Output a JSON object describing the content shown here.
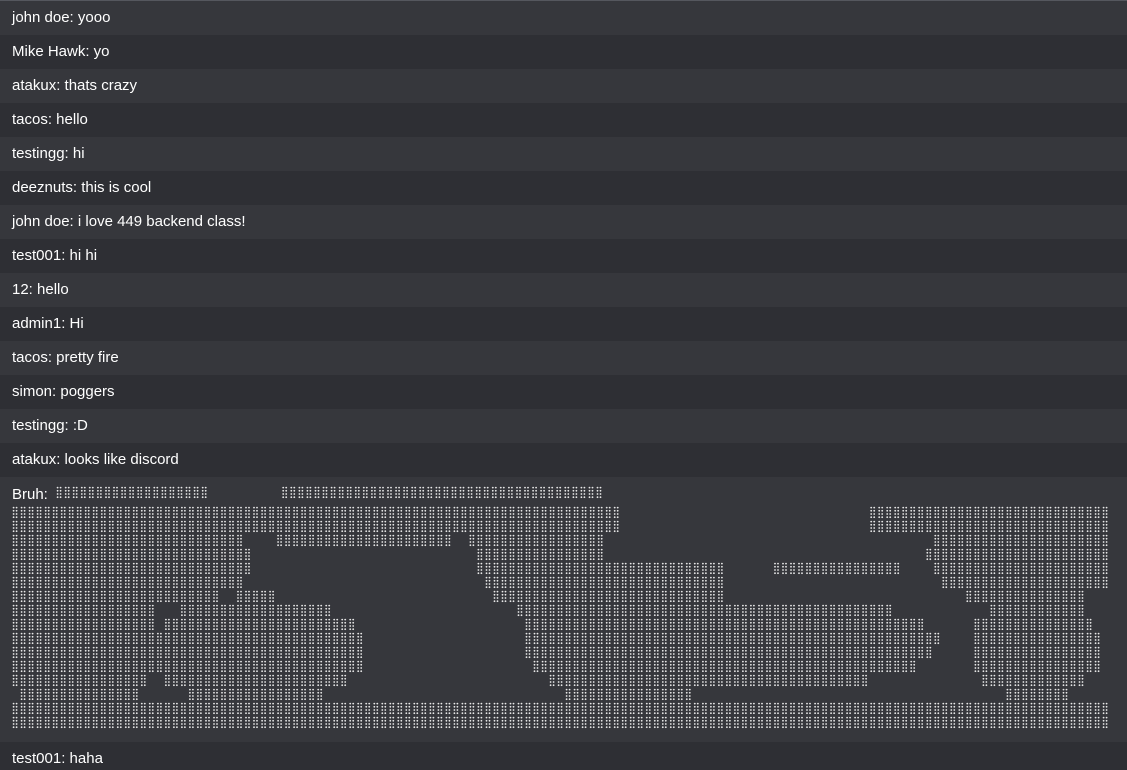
{
  "messages": [
    {
      "user": "john doe",
      "text": "yooo"
    },
    {
      "user": "Mike Hawk",
      "text": "yo"
    },
    {
      "user": "atakux",
      "text": "thats crazy"
    },
    {
      "user": "tacos",
      "text": "hello"
    },
    {
      "user": "testingg",
      "text": "hi"
    },
    {
      "user": "deeznuts",
      "text": "this is cool"
    },
    {
      "user": "john doe",
      "text": "i love 449 backend class!"
    },
    {
      "user": "test001",
      "text": "hi hi"
    },
    {
      "user": "12",
      "text": "hello"
    },
    {
      "user": "admin1",
      "text": "Hi"
    },
    {
      "user": "tacos",
      "text": "pretty fire"
    },
    {
      "user": "simon",
      "text": "poggers"
    },
    {
      "user": "testingg",
      "text": ":D"
    },
    {
      "user": "atakux",
      "text": "looks like discord"
    }
  ],
  "art_message": {
    "user": "Bruh"
  },
  "last_message": {
    "user": "test001",
    "text": "haha"
  },
  "colors": {
    "bg_dark": "#2e2f34",
    "bg_light": "#36373c",
    "text": "#ffffff",
    "braille_dot": "#e8e8e8"
  }
}
